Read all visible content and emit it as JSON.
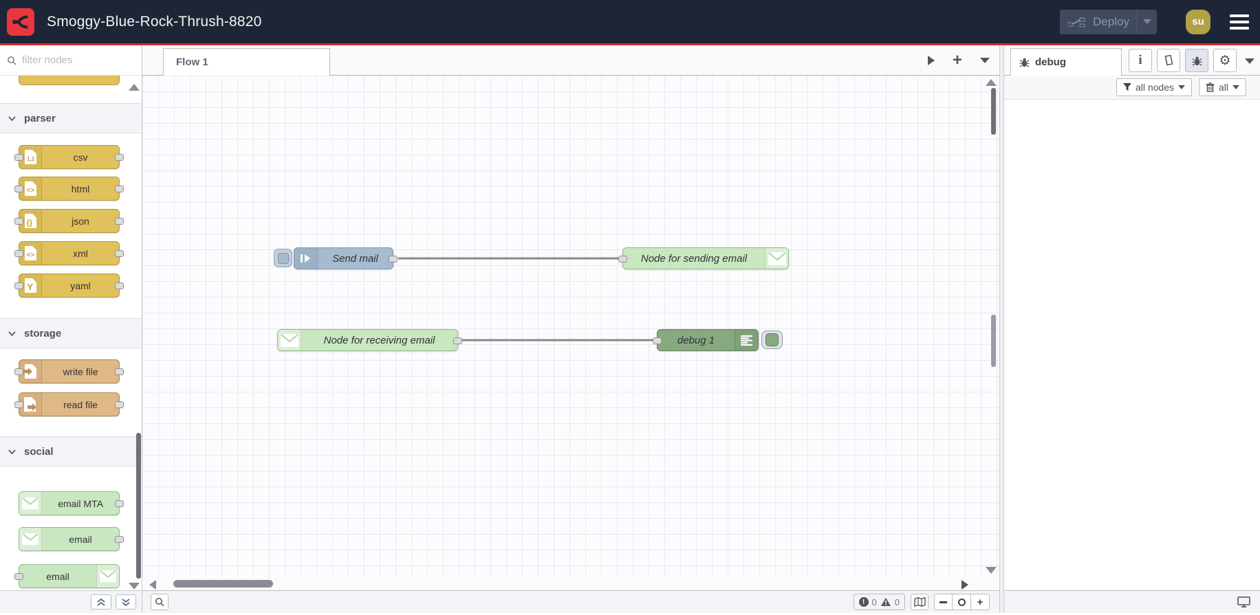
{
  "header": {
    "title": "Smoggy-Blue-Rock-Thrush-8820",
    "deploy_label": "Deploy",
    "user_initials": "su"
  },
  "palette": {
    "search_placeholder": "filter nodes",
    "categories": [
      {
        "label": "parser",
        "nodes": [
          {
            "label": "csv"
          },
          {
            "label": "html"
          },
          {
            "label": "json"
          },
          {
            "label": "xml"
          },
          {
            "label": "yaml"
          }
        ]
      },
      {
        "label": "storage",
        "nodes": [
          {
            "label": "write file"
          },
          {
            "label": "read file"
          }
        ]
      },
      {
        "label": "social",
        "nodes": [
          {
            "label": "email MTA"
          },
          {
            "label": "email"
          },
          {
            "label": "email"
          }
        ]
      }
    ]
  },
  "workspace": {
    "tab_label": "Flow 1",
    "nodes": [
      {
        "label": "Send mail",
        "type": "inject"
      },
      {
        "label": "Node for sending email",
        "type": "email out"
      },
      {
        "label": "Node for receiving email",
        "type": "email in"
      },
      {
        "label": "debug 1",
        "type": "debug"
      }
    ]
  },
  "sidebar": {
    "tab_label": "debug",
    "filter_label": "all nodes",
    "clear_label": "all"
  },
  "statusbar": {
    "error_count": "0",
    "warning_count": "0"
  },
  "colors": {
    "header_bg": "#1d2536",
    "accent_red": "#d22c2c",
    "inject_blue": "#a6bbcf",
    "parser_yellow": "#e1c15b",
    "storage_tan": "#deb887",
    "email_green": "#c9e7c0",
    "debug_green": "#87a980",
    "avatar_gold": "#b0a245"
  }
}
